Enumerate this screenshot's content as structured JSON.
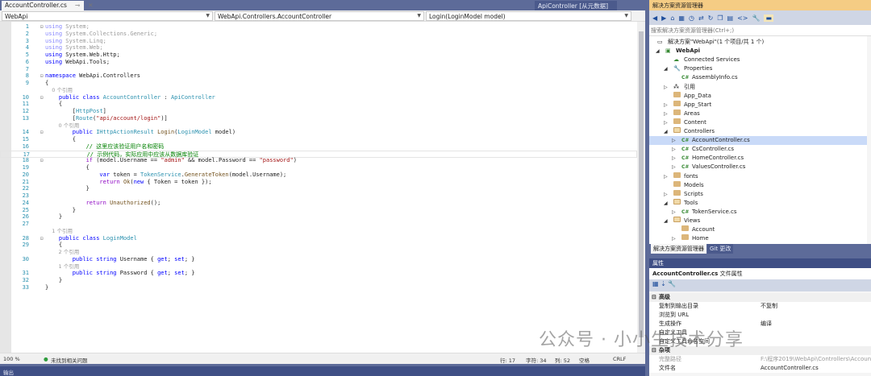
{
  "editor": {
    "tab_title": "AccountController.cs",
    "tab_pin": "⊸",
    "tab_close": "✕",
    "meta_tab": "ApiController [从元数据]",
    "nav": {
      "project": "WebApi",
      "class": "WebApi.Controllers.AccountController",
      "member": "Login(LoginModel model)"
    },
    "rows": [
      {
        "n": "1",
        "f": "⊟",
        "s": [
          [
            "using",
            "dk"
          ],
          [
            " System;",
            "d"
          ]
        ]
      },
      {
        "n": "2",
        "s": [
          [
            "using",
            "dk"
          ],
          [
            " System.Collections.Generic;",
            "d"
          ]
        ]
      },
      {
        "n": "3",
        "s": [
          [
            "using",
            "dk"
          ],
          [
            " System.Linq;",
            "d"
          ]
        ]
      },
      {
        "n": "4",
        "s": [
          [
            "using",
            "dk"
          ],
          [
            " System.Web;",
            "d"
          ]
        ]
      },
      {
        "n": "5",
        "s": [
          [
            "using",
            "k"
          ],
          [
            " System.Web.Http;",
            ""
          ]
        ]
      },
      {
        "n": "6",
        "s": [
          [
            "using",
            "k"
          ],
          [
            " WebApi.Tools;",
            ""
          ]
        ]
      },
      {
        "n": "7",
        "s": []
      },
      {
        "n": "8",
        "f": "⊟",
        "s": [
          [
            "namespace",
            "k"
          ],
          [
            " WebApi.Controllers",
            ""
          ]
        ]
      },
      {
        "n": "9",
        "s": [
          [
            "{",
            ""
          ]
        ]
      },
      {
        "ref": "    0 个引用"
      },
      {
        "n": "10",
        "f": "⊟",
        "s": [
          [
            "    public class ",
            "k"
          ],
          [
            "AccountController",
            "t"
          ],
          [
            " : ",
            ""
          ],
          [
            "ApiController",
            "t"
          ]
        ]
      },
      {
        "n": "11",
        "s": [
          [
            "    {",
            ""
          ]
        ]
      },
      {
        "n": "12",
        "s": [
          [
            "        [",
            ""
          ],
          [
            "HttpPost",
            "t"
          ],
          [
            "]",
            ""
          ]
        ]
      },
      {
        "n": "13",
        "s": [
          [
            "        [",
            ""
          ],
          [
            "Route",
            "t"
          ],
          [
            "(",
            ""
          ],
          [
            "\"api/account/login\"",
            "s"
          ],
          [
            ")]",
            ""
          ]
        ]
      },
      {
        "ref": "        0 个引用"
      },
      {
        "n": "14",
        "f": "⊟",
        "s": [
          [
            "        public ",
            "k"
          ],
          [
            "IHttpActionResult",
            "t"
          ],
          [
            " ",
            ""
          ],
          [
            "Login",
            "m"
          ],
          [
            "(",
            ""
          ],
          [
            "LoginModel",
            "t"
          ],
          [
            " model",
            ""
          ],
          [
            ")",
            ""
          ]
        ]
      },
      {
        "n": "15",
        "s": [
          [
            "        {",
            ""
          ]
        ]
      },
      {
        "n": "16",
        "s": [
          [
            "            // 这里应该验证用户名和密码",
            "c"
          ]
        ]
      },
      {
        "n": "17",
        "cur": true,
        "s": [
          [
            "            // 示例代码，实际应用中应该从数据库验证",
            "c"
          ]
        ]
      },
      {
        "n": "18",
        "f": "⊟",
        "s": [
          [
            "            if",
            "p"
          ],
          [
            " (model.Username == ",
            ""
          ],
          [
            "\"admin\"",
            "s"
          ],
          [
            " && model.Password == ",
            ""
          ],
          [
            "\"password\"",
            "s"
          ],
          [
            ")",
            ""
          ]
        ]
      },
      {
        "n": "19",
        "s": [
          [
            "            {",
            ""
          ]
        ]
      },
      {
        "n": "20",
        "s": [
          [
            "                var",
            "k"
          ],
          [
            " token = ",
            ""
          ],
          [
            "TokenService",
            "t"
          ],
          [
            ".",
            ""
          ],
          [
            "GenerateToken",
            "m"
          ],
          [
            "(model.Username);",
            ""
          ]
        ]
      },
      {
        "n": "21",
        "s": [
          [
            "                return",
            "p"
          ],
          [
            " ",
            ""
          ],
          [
            "Ok",
            "m"
          ],
          [
            "(",
            ""
          ],
          [
            "new",
            "k"
          ],
          [
            " { Token = token });",
            ""
          ]
        ]
      },
      {
        "n": "22",
        "s": [
          [
            "            }",
            ""
          ]
        ]
      },
      {
        "n": "23",
        "s": []
      },
      {
        "n": "24",
        "s": [
          [
            "            return",
            "p"
          ],
          [
            " ",
            ""
          ],
          [
            "Unauthorized",
            "m"
          ],
          [
            "();",
            ""
          ]
        ]
      },
      {
        "n": "25",
        "s": [
          [
            "        }",
            ""
          ]
        ]
      },
      {
        "n": "26",
        "s": [
          [
            "    }",
            ""
          ]
        ]
      },
      {
        "n": "27",
        "s": []
      },
      {
        "ref": "    1 个引用"
      },
      {
        "n": "28",
        "f": "⊟",
        "s": [
          [
            "    public class ",
            "k"
          ],
          [
            "LoginModel",
            "t"
          ]
        ]
      },
      {
        "n": "29",
        "s": [
          [
            "    {",
            ""
          ]
        ]
      },
      {
        "ref": "        2 个引用"
      },
      {
        "n": "30",
        "s": [
          [
            "        public string ",
            "k"
          ],
          [
            "Username { ",
            ""
          ],
          [
            "get",
            "k"
          ],
          [
            "; ",
            ""
          ],
          [
            "set",
            "k"
          ],
          [
            "; }",
            ""
          ]
        ]
      },
      {
        "ref": "        1 个引用"
      },
      {
        "n": "31",
        "s": [
          [
            "        public string ",
            "k"
          ],
          [
            "Password { ",
            ""
          ],
          [
            "get",
            "k"
          ],
          [
            "; ",
            ""
          ],
          [
            "set",
            "k"
          ],
          [
            "; }",
            ""
          ]
        ]
      },
      {
        "n": "32",
        "s": [
          [
            "    }",
            ""
          ]
        ]
      },
      {
        "n": "33",
        "s": [
          [
            "}",
            ""
          ]
        ]
      }
    ]
  },
  "status": {
    "zoom": "100 %",
    "issues": "未找到相关问题",
    "line": "行: 17",
    "char": "字符: 34",
    "col": "列: 52",
    "ws": "空格",
    "eol": "CRLF"
  },
  "output": {
    "title": "输出"
  },
  "solution_explorer": {
    "title": "解决方案资源管理器",
    "search_placeholder": "搜索解决方案资源管理器(Ctrl+;)",
    "items": [
      {
        "label": "解决方案\"WebApi\"(1 个项目/共 1 个)",
        "level": 0,
        "icon": "solution-icon"
      },
      {
        "label": "WebApi",
        "level": 1,
        "icon": "project-icon",
        "arrow": "◢",
        "bold": true
      },
      {
        "label": "Connected Services",
        "level": 2,
        "icon": "connected-services-icon"
      },
      {
        "label": "Properties",
        "level": 2,
        "icon": "wrench-icon",
        "arrow": "◢"
      },
      {
        "label": "AssemblyInfo.cs",
        "level": 3,
        "icon": "csharp-file-icon"
      },
      {
        "label": "引用",
        "level": 2,
        "icon": "references-icon",
        "arrow": "▷"
      },
      {
        "label": "App_Data",
        "level": 2,
        "icon": "folder-icon"
      },
      {
        "label": "App_Start",
        "level": 2,
        "icon": "folder-icon",
        "arrow": "▷"
      },
      {
        "label": "Areas",
        "level": 2,
        "icon": "folder-icon",
        "arrow": "▷"
      },
      {
        "label": "Content",
        "level": 2,
        "icon": "folder-icon",
        "arrow": "▷"
      },
      {
        "label": "Controllers",
        "level": 2,
        "icon": "folder-open-icon",
        "arrow": "◢"
      },
      {
        "label": "AccountController.cs",
        "level": 3,
        "icon": "csharp-file-icon",
        "arrow": "▷",
        "selected": true
      },
      {
        "label": "CsController.cs",
        "level": 3,
        "icon": "csharp-file-icon",
        "arrow": "▷"
      },
      {
        "label": "HomeController.cs",
        "level": 3,
        "icon": "csharp-file-icon",
        "arrow": "▷"
      },
      {
        "label": "ValuesController.cs",
        "level": 3,
        "icon": "csharp-file-icon",
        "arrow": "▷"
      },
      {
        "label": "fonts",
        "level": 2,
        "icon": "folder-icon",
        "arrow": "▷"
      },
      {
        "label": "Models",
        "level": 2,
        "icon": "folder-icon"
      },
      {
        "label": "Scripts",
        "level": 2,
        "icon": "folder-icon",
        "arrow": "▷"
      },
      {
        "label": "Tools",
        "level": 2,
        "icon": "folder-open-icon",
        "arrow": "◢"
      },
      {
        "label": "TokenService.cs",
        "level": 3,
        "icon": "csharp-file-icon",
        "arrow": "▷"
      },
      {
        "label": "Views",
        "level": 2,
        "icon": "folder-open-icon",
        "arrow": "◢"
      },
      {
        "label": "Account",
        "level": 3,
        "icon": "folder-icon"
      },
      {
        "label": "Home",
        "level": 3,
        "icon": "folder-icon",
        "arrow": "▷"
      }
    ],
    "tabs": [
      "解决方案资源管理器",
      "Git 更改"
    ]
  },
  "properties": {
    "title": "属性",
    "object": "AccountController.cs",
    "object_type": "文件属性",
    "rows": [
      {
        "cat": true,
        "name": "高级"
      },
      {
        "name": "复制到输出目录",
        "value": "不复制"
      },
      {
        "name": "浏览到 URL",
        "value": ""
      },
      {
        "name": "生成操作",
        "value": "编译"
      },
      {
        "name": "自定义工具",
        "value": ""
      },
      {
        "name": "自定义工具命名空间",
        "value": ""
      },
      {
        "cat": true,
        "name": "杂项"
      },
      {
        "name": "完整路径",
        "value": "F:\\程序2019\\WebApi\\Controllers\\AccountController.cs",
        "dim": true
      },
      {
        "name": "文件名",
        "value": "AccountController.cs"
      }
    ]
  },
  "watermark": "公众号 · 小小生技术分享",
  "colors": {
    "keyword": "#0000ff",
    "type": "#2b91af",
    "string": "#a31515",
    "comment": "#008000",
    "accent_title": "#f5cc84",
    "chrome": "#5d6b99"
  }
}
